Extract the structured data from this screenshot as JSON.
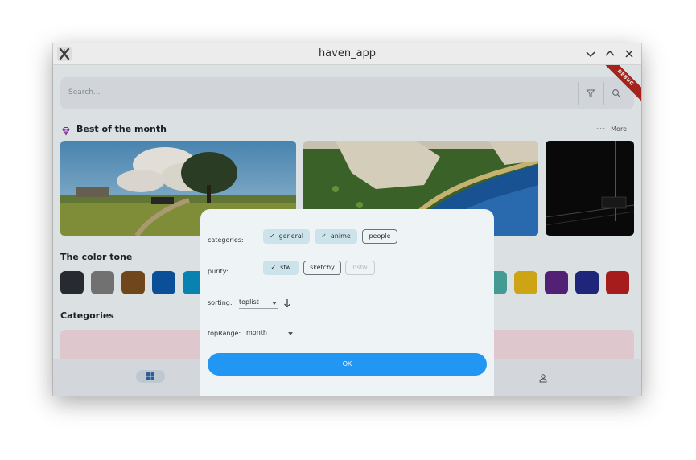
{
  "window": {
    "title": "haven_app"
  },
  "search": {
    "placeholder": "Search..."
  },
  "debug_banner": "DEBUG",
  "sections": {
    "best": {
      "title": "Best of the month",
      "more_label": "More"
    },
    "color_tone": {
      "title": "The color tone"
    },
    "categories": {
      "title": "Categories"
    }
  },
  "swatch_colors_left": [
    "#2b2f36",
    "#7b7b7b",
    "#7a4e1f",
    "#0b56a4",
    "#0a8cc0"
  ],
  "swatch_colors_right": [
    "#4aa9a0",
    "#e0b21a",
    "#5a237e",
    "#222a84",
    "#b51f20"
  ],
  "dialog": {
    "categories": {
      "label": "categories:",
      "chips": [
        {
          "label": "general",
          "selected": true
        },
        {
          "label": "anime",
          "selected": true
        },
        {
          "label": "people",
          "selected": false
        }
      ]
    },
    "purity": {
      "label": "purity:",
      "chips": [
        {
          "label": "sfw",
          "selected": true
        },
        {
          "label": "sketchy",
          "selected": false
        },
        {
          "label": "nsfw",
          "selected": false,
          "disabled": true
        }
      ]
    },
    "sorting": {
      "label": "sorting:",
      "value": "toplist"
    },
    "top_range": {
      "label": "topRange:",
      "value": "month"
    },
    "ok_label": "OK"
  },
  "colors": {
    "accent": "#2196f3",
    "chip_selected": "#cde3ec",
    "debug": "#b3261e"
  }
}
